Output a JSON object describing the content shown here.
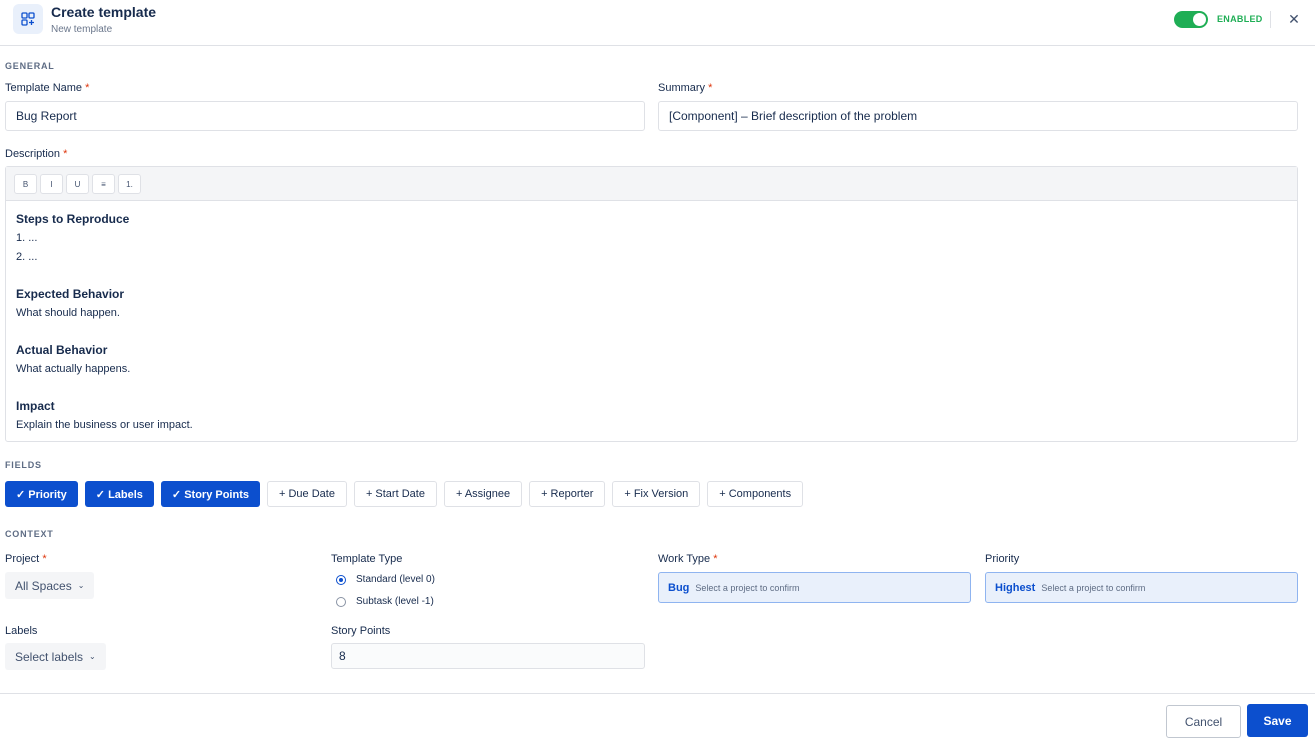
{
  "header": {
    "title": "Create template",
    "subtitle": "New template",
    "status_label": "ENABLED",
    "enabled": true,
    "icon": "template-icon",
    "close_icon": "close-icon"
  },
  "general": {
    "section_label": "GENERAL",
    "template_name_label": "Template Name",
    "template_name_value": "Bug Report",
    "summary_label": "Summary",
    "summary_value": "[Component] – Brief description of the problem",
    "description_label": "Description",
    "required_mark": "*",
    "toolbar": [
      "B",
      "I",
      "U",
      "≡",
      "1."
    ],
    "description": {
      "steps_heading": "Steps to Reproduce",
      "step1": "1. ...",
      "step2": "2. ...",
      "expected_heading": "Expected Behavior",
      "expected_text": "What should happen.",
      "actual_heading": "Actual Behavior",
      "actual_text": "What actually happens.",
      "impact_heading": "Impact",
      "impact_text": "Explain the business or user impact."
    }
  },
  "fields": {
    "section_label": "FIELDS",
    "chips": [
      {
        "label": "✓ Priority",
        "selected": true
      },
      {
        "label": "✓ Labels",
        "selected": true
      },
      {
        "label": "✓ Story Points",
        "selected": true
      },
      {
        "label": "+ Due Date",
        "selected": false
      },
      {
        "label": "+ Start Date",
        "selected": false
      },
      {
        "label": "+ Assignee",
        "selected": false
      },
      {
        "label": "+ Reporter",
        "selected": false
      },
      {
        "label": "+ Fix Version",
        "selected": false
      },
      {
        "label": "+ Components",
        "selected": false
      }
    ]
  },
  "context": {
    "section_label": "CONTEXT",
    "project_label": "Project",
    "project_value": "All Spaces",
    "template_type_label": "Template Type",
    "template_type_options": [
      "Standard (level 0)",
      "Subtask (level -1)"
    ],
    "template_type_selected": "Standard (level 0)",
    "work_type_label": "Work Type",
    "work_type_value": "Bug",
    "work_type_hint": "Select a project to confirm",
    "priority_label": "Priority",
    "priority_value": "Highest",
    "priority_hint": "Select a project to confirm",
    "labels_label": "Labels",
    "labels_value": "Select labels",
    "story_points_label": "Story Points",
    "story_points_value": "8"
  },
  "footer": {
    "cancel_label": "Cancel",
    "save_label": "Save"
  },
  "colors": {
    "accent": "#0c4fce",
    "enabled_green": "#1fae55",
    "required_red": "#de350b"
  }
}
